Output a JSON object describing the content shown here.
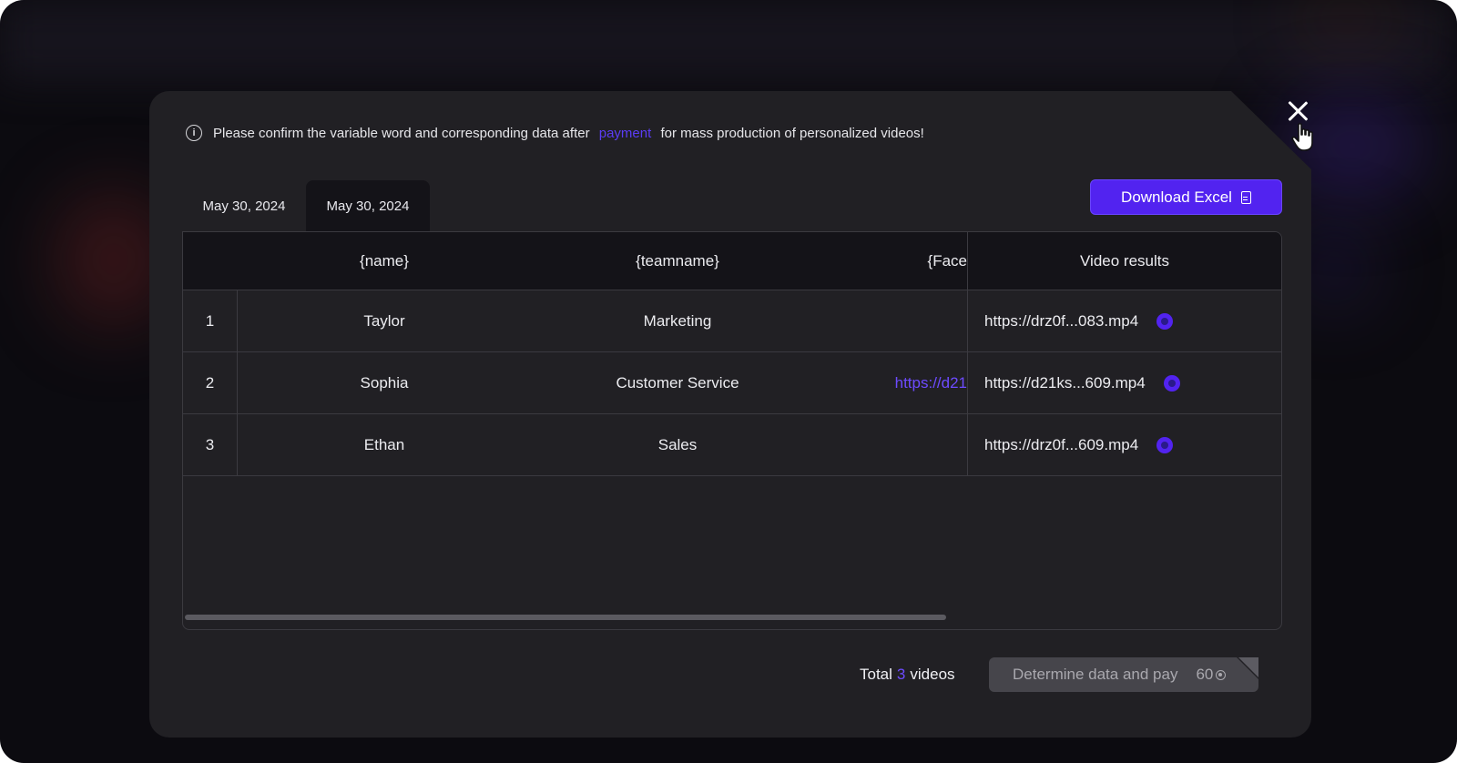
{
  "notice": {
    "text_before": "Please confirm the variable word and corresponding data after",
    "link_text": "payment",
    "text_after": "for mass production of personalized videos!"
  },
  "tabs": [
    {
      "label": "May 30, 2024",
      "active": false
    },
    {
      "label": "May 30, 2024",
      "active": true
    }
  ],
  "download_button": {
    "label": "Download Excel",
    "icon": "document-icon"
  },
  "table": {
    "headers": {
      "name": "{name}",
      "teamname": "{teamname}",
      "face": "{Face",
      "video": "Video results"
    },
    "rows": [
      {
        "index": "1",
        "name": "Taylor",
        "teamname": "Marketing",
        "face": "",
        "video": "https://drz0f...083.mp4"
      },
      {
        "index": "2",
        "name": "Sophia",
        "teamname": "Customer Service",
        "face": "https://d21",
        "video": "https://d21ks...609.mp4"
      },
      {
        "index": "3",
        "name": "Ethan",
        "teamname": "Sales",
        "face": "",
        "video": "https://drz0f...609.mp4"
      }
    ]
  },
  "footer": {
    "total_prefix": "Total",
    "total_count": "3",
    "total_suffix": "videos",
    "pay_label": "Determine data and pay",
    "pay_cost": "60"
  },
  "colors": {
    "accent": "#5223f0",
    "modal_bg": "#212024",
    "header_bg": "#141318"
  }
}
